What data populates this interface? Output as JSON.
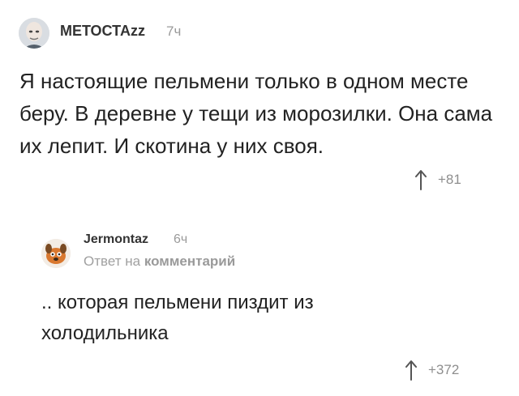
{
  "comments": [
    {
      "username": "МЕТОСТАzz",
      "time": "7ч",
      "text": "Я настоящие пельмени только в одном месте беру. В деревне у тещи из морозилки. Она сама их лепит. И скотина у них своя.",
      "rating": "+81",
      "avatar_icon": "bald-man-avatar"
    },
    {
      "username": "Jermontaz",
      "time": "6ч",
      "reply_prefix": "Ответ на",
      "reply_target": "комментарий",
      "text": ".. которая пельмени пиздит из холодильника",
      "rating": "+372",
      "avatar_icon": "cartoon-dog-avatar"
    }
  ]
}
